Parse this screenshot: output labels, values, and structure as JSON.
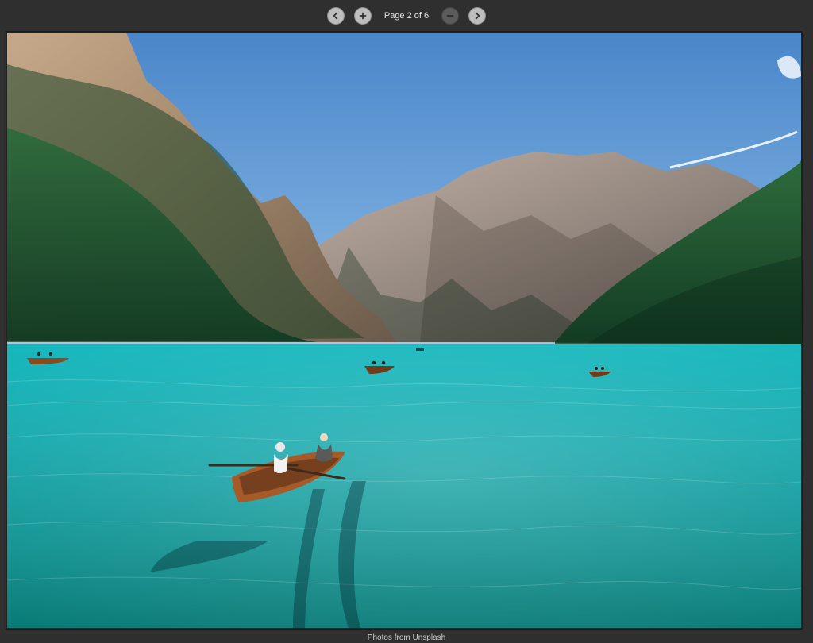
{
  "viewer": {
    "pagination_label": "Page 2 of 6",
    "caption": "Photos from Unsplash"
  },
  "icons": {
    "prev": "chevron-left-icon",
    "zoom_in": "plus-icon",
    "zoom_out": "minus-icon",
    "next": "chevron-right-icon"
  },
  "colors": {
    "toolbar_bg": "#2f2f2f",
    "button": "#bdbdbd",
    "button_disabled": "#5b5b5b",
    "sky_top": "#4a86c9",
    "sky_bottom": "#cfe6ff",
    "lake_top": "#17b3b7",
    "lake_bottom": "#0a7b77"
  }
}
